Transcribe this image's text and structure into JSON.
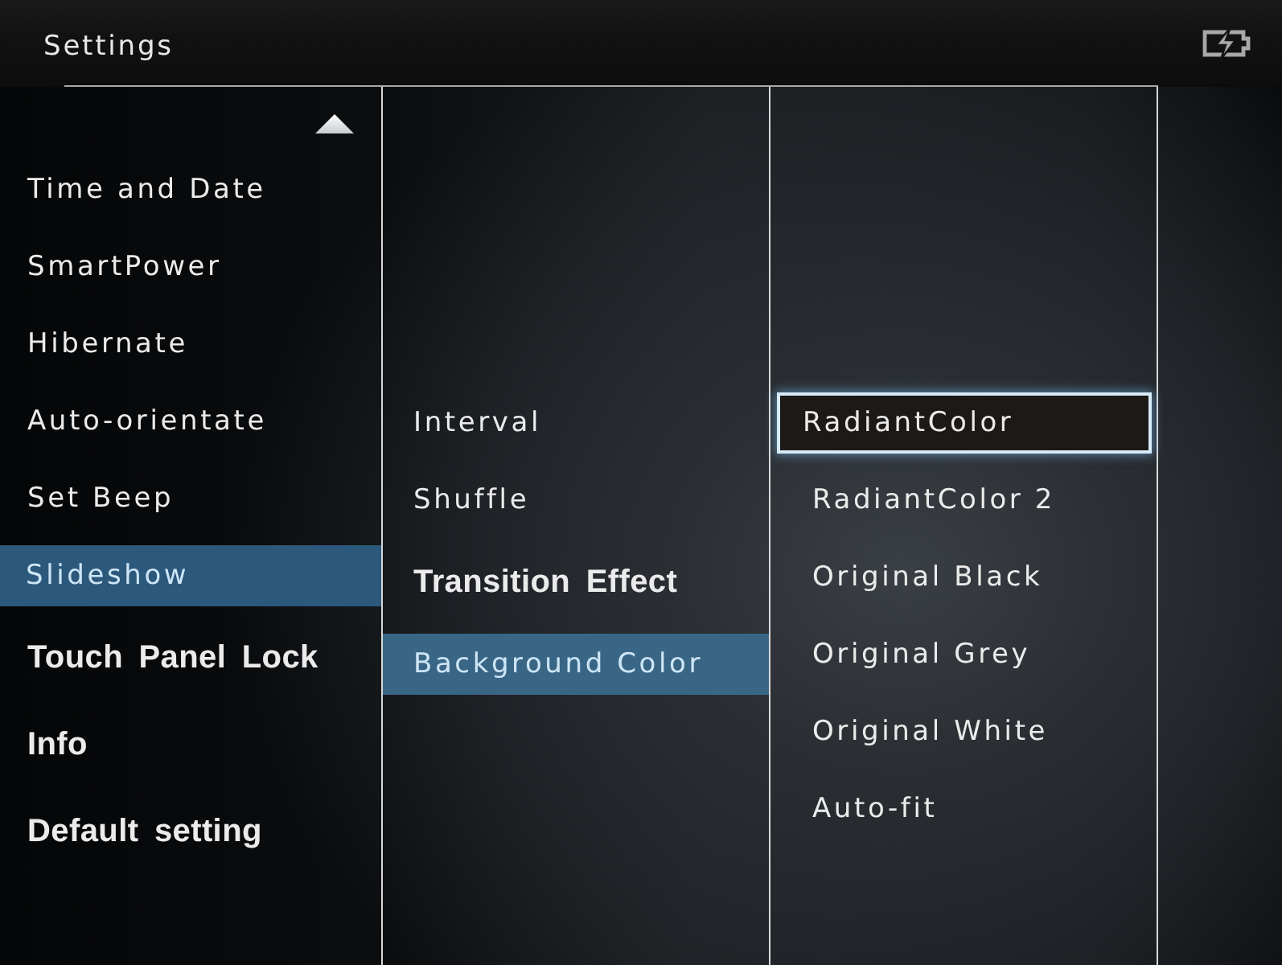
{
  "header": {
    "title": "Settings"
  },
  "menu": {
    "items": [
      {
        "label": "Time and Date",
        "kind": "spaced",
        "selected": false
      },
      {
        "label": "SmartPower",
        "kind": "spaced",
        "selected": false
      },
      {
        "label": "Hibernate",
        "kind": "spaced",
        "selected": false
      },
      {
        "label": "Auto-orientate",
        "kind": "spaced",
        "selected": false
      },
      {
        "label": "Set Beep",
        "kind": "spaced",
        "selected": false
      },
      {
        "label": "Slideshow",
        "kind": "spaced",
        "selected": true
      },
      {
        "label": "Touch Panel Lock",
        "kind": "bold",
        "selected": false
      },
      {
        "label": "Info",
        "kind": "bold",
        "selected": false
      },
      {
        "label": "Default setting",
        "kind": "bold",
        "selected": false
      }
    ]
  },
  "submenu": {
    "items": [
      {
        "label": "Interval",
        "kind": "spaced",
        "selected": false
      },
      {
        "label": "Shuffle",
        "kind": "spaced",
        "selected": false
      },
      {
        "label": "Transition Effect",
        "kind": "bold",
        "selected": false
      },
      {
        "label": "Background Color",
        "kind": "spaced",
        "selected": true
      }
    ]
  },
  "options": {
    "items": [
      {
        "label": "RadiantColor",
        "selected": true
      },
      {
        "label": "RadiantColor 2",
        "selected": false
      },
      {
        "label": "Original Black",
        "selected": false
      },
      {
        "label": "Original Grey",
        "selected": false
      },
      {
        "label": "Original White",
        "selected": false
      },
      {
        "label": "Auto-fit",
        "selected": false
      }
    ]
  }
}
